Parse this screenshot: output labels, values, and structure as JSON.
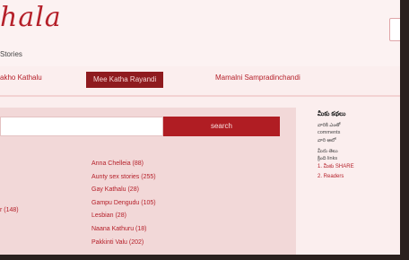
{
  "header": {
    "logo_text": "hala",
    "tagline": "Stories"
  },
  "nav": {
    "items": [
      {
        "label": "akho Kathalu",
        "active": false
      },
      {
        "label": "Mee Katha Rayandi",
        "active": true
      },
      {
        "label": "Mamalni Sampradinchandi",
        "active": false
      }
    ]
  },
  "search": {
    "value": "",
    "button_label": "search"
  },
  "tags": {
    "left": [
      {
        "label": "r (148)"
      }
    ],
    "right": [
      {
        "label": "Anna Chelleia (88)"
      },
      {
        "label": "Aunty sex stories (255)"
      },
      {
        "label": "Gay Kathalu (28)"
      },
      {
        "label": "Gampu Dengudu (105)"
      },
      {
        "label": "Lesbian (28)"
      },
      {
        "label": "Naana Kathuru (18)"
      },
      {
        "label": "Pakkinti Valu (202)"
      }
    ]
  },
  "aside": {
    "title": "మీకు కథలు",
    "lines": [
      "వారికి ఎంతో",
      "comments",
      "వారి ఆలో",
      "",
      "మీరు తెలు",
      "క్రింది links"
    ],
    "links": [
      "1. మీకు SHARE",
      "2. Readers"
    ]
  },
  "colors": {
    "accent": "#b01d23",
    "active_nav": "#8f1b1f",
    "background": "#fbeeee",
    "panel": "#f2d8d8"
  }
}
